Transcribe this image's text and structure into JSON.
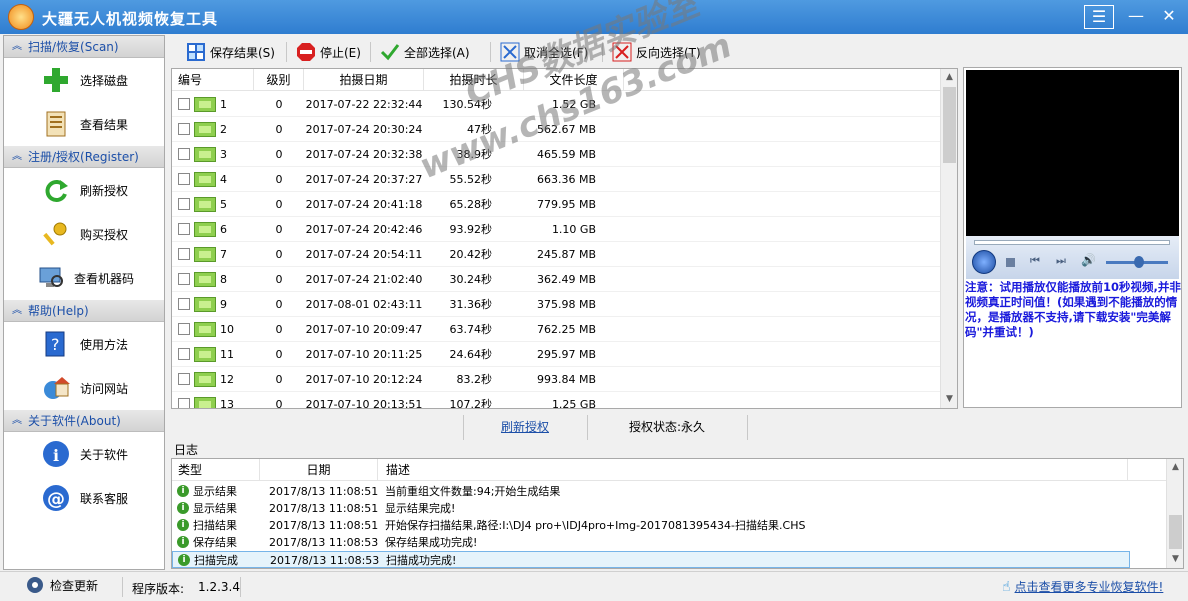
{
  "window": {
    "title": "大疆无人机视频恢复工具"
  },
  "sidebar": {
    "sections": [
      {
        "header": "扫描/恢复(Scan)",
        "items": [
          {
            "label": "选择磁盘",
            "icon": "green-plus-icon"
          },
          {
            "label": "查看结果",
            "icon": "document-icon"
          }
        ]
      },
      {
        "header": "注册/授权(Register)",
        "items": [
          {
            "label": "刷新授权",
            "icon": "refresh-icon"
          },
          {
            "label": "购买授权",
            "icon": "key-icon"
          },
          {
            "label": "查看机器码",
            "icon": "computer-search-icon"
          }
        ]
      },
      {
        "header": "帮助(Help)",
        "items": [
          {
            "label": "使用方法",
            "icon": "help-book-icon"
          },
          {
            "label": "访问网站",
            "icon": "home-globe-icon"
          }
        ]
      },
      {
        "header": "关于软件(About)",
        "items": [
          {
            "label": "关于软件",
            "icon": "info-icon"
          },
          {
            "label": "联系客服",
            "icon": "at-sign-icon"
          }
        ]
      }
    ]
  },
  "toolbar": {
    "save": "保存结果(S)",
    "stop": "停止(E)",
    "select_all": "全部选择(A)",
    "deselect_all": "取消全选(F)",
    "invert": "反向选择(T)"
  },
  "table": {
    "columns": [
      "编号",
      "级别",
      "拍摄日期",
      "拍摄时长",
      "文件长度"
    ],
    "rows": [
      {
        "id": "1",
        "level": "0",
        "date": "2017-07-22 22:32:44",
        "duration": "130.54秒",
        "size": "1.52 GB"
      },
      {
        "id": "2",
        "level": "0",
        "date": "2017-07-24 20:30:24",
        "duration": "47秒",
        "size": "562.67 MB"
      },
      {
        "id": "3",
        "level": "0",
        "date": "2017-07-24 20:32:38",
        "duration": "38.9秒",
        "size": "465.59 MB"
      },
      {
        "id": "4",
        "level": "0",
        "date": "2017-07-24 20:37:27",
        "duration": "55.52秒",
        "size": "663.36 MB"
      },
      {
        "id": "5",
        "level": "0",
        "date": "2017-07-24 20:41:18",
        "duration": "65.28秒",
        "size": "779.95 MB"
      },
      {
        "id": "6",
        "level": "0",
        "date": "2017-07-24 20:42:46",
        "duration": "93.92秒",
        "size": "1.10 GB"
      },
      {
        "id": "7",
        "level": "0",
        "date": "2017-07-24 20:54:11",
        "duration": "20.42秒",
        "size": "245.87 MB"
      },
      {
        "id": "8",
        "level": "0",
        "date": "2017-07-24 21:02:40",
        "duration": "30.24秒",
        "size": "362.49 MB"
      },
      {
        "id": "9",
        "level": "0",
        "date": "2017-08-01 02:43:11",
        "duration": "31.36秒",
        "size": "375.98 MB"
      },
      {
        "id": "10",
        "level": "0",
        "date": "2017-07-10 20:09:47",
        "duration": "63.74秒",
        "size": "762.25 MB"
      },
      {
        "id": "11",
        "level": "0",
        "date": "2017-07-10 20:11:25",
        "duration": "24.64秒",
        "size": "295.97 MB"
      },
      {
        "id": "12",
        "level": "0",
        "date": "2017-07-10 20:12:24",
        "duration": "83.2秒",
        "size": "993.84 MB"
      },
      {
        "id": "13",
        "level": "0",
        "date": "2017-07-10 20:13:51",
        "duration": "107.2秒",
        "size": "1.25 GB"
      }
    ]
  },
  "player": {
    "note": "注意：试用播放仅能播放前10秒视频,并非视频真正时间值！(如果遇到不能播放的情况，是播放器不支持,请下载安装\"完美解码\"并重试！)"
  },
  "midbar": {
    "refresh_link": "刷新授权",
    "auth_status": "授权状态:永久"
  },
  "log": {
    "title": "日志",
    "columns": [
      "类型",
      "日期",
      "描述"
    ],
    "rows": [
      {
        "type": "显示结果",
        "date": "2017/8/13 11:08:51",
        "desc": "当前重组文件数量:94;开始生成结果"
      },
      {
        "type": "显示结果",
        "date": "2017/8/13 11:08:51",
        "desc": "显示结果完成!"
      },
      {
        "type": "扫描结果",
        "date": "2017/8/13 11:08:51",
        "desc": "开始保存扫描结果,路径:I:\\DJ4 pro+\\IDJ4pro+Img-2017081395434-扫描结果.CHS"
      },
      {
        "type": "保存结果",
        "date": "2017/8/13 11:08:53",
        "desc": "保存结果成功完成!"
      },
      {
        "type": "扫描完成",
        "date": "2017/8/13 11:08:53",
        "desc": "扫描成功完成!"
      }
    ]
  },
  "statusbar": {
    "check_update": "检查更新",
    "version_label": "程序版本:",
    "version": "1.2.3.4",
    "more_link": "点击查看更多专业恢复软件!"
  },
  "watermark": {
    "line1": "CHS数据实验室",
    "line2": "www.chs163.com"
  },
  "colors": {
    "title_bar": "#2f7dd0",
    "section_header_text": "#1c4fa8",
    "note_text": "#1a1adc",
    "link": "#1c4fa8"
  }
}
